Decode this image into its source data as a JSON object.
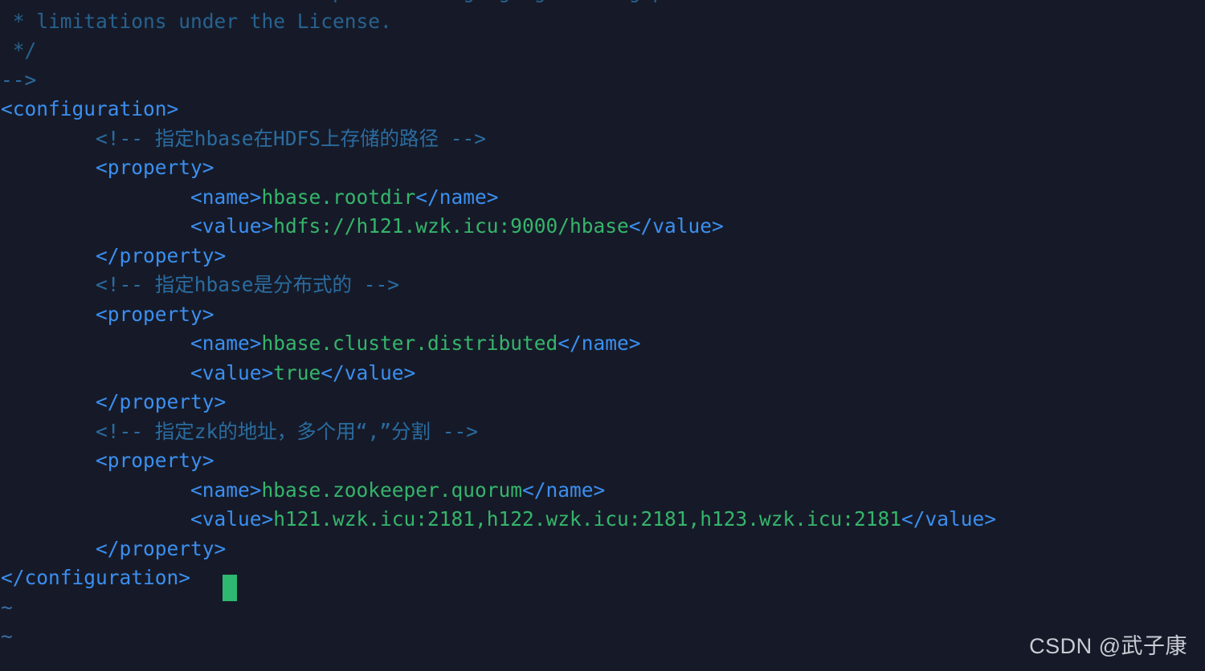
{
  "app": {
    "type": "terminal-text-editor",
    "editor": "vim",
    "file": "hbase-site.xml",
    "mode": "normal"
  },
  "theme": {
    "background": "#161a28",
    "tag_color": "#3b8ff0",
    "text_color": "#35b56b",
    "comment_color": "#2a6ca0",
    "dim_comment_color": "#27628f",
    "tilde_color": "#3b6ea8",
    "cursor_color": "#2eb872",
    "watermark_color": "#c9ccd4"
  },
  "cursor": {
    "line": 20,
    "column": 17,
    "shape": "block"
  },
  "lines": [
    {
      "id": "line-license-see",
      "indent": 1,
      "kind": "comment-dim",
      "clipped": true,
      "segments": [
        {
          "cls": "c-comment-d",
          "text": "* See the License for the specific language governing permissions and"
        }
      ]
    },
    {
      "id": "line-license-limitations",
      "indent": 1,
      "kind": "comment-dim",
      "segments": [
        {
          "cls": "c-comment-d",
          "text": "* limitations under the License."
        }
      ]
    },
    {
      "id": "line-comment-close-star",
      "indent": 1,
      "kind": "comment-dim",
      "segments": [
        {
          "cls": "c-comment-d",
          "text": "*/"
        }
      ]
    },
    {
      "id": "line-comment-close-xml",
      "indent": 0,
      "kind": "comment",
      "segments": [
        {
          "cls": "c-comment",
          "text": "-->"
        }
      ]
    },
    {
      "id": "line-configuration-open",
      "indent": 0,
      "kind": "tag",
      "segments": [
        {
          "cls": "c-tag",
          "text": "<configuration>"
        }
      ]
    },
    {
      "id": "line-comment-rootdir",
      "indent": 8,
      "kind": "comment",
      "segments": [
        {
          "cls": "c-comment",
          "text": "<!-- 指定hbase在HDFS上存储的路径 -->"
        }
      ]
    },
    {
      "id": "line-property-open-1",
      "indent": 8,
      "kind": "tag",
      "segments": [
        {
          "cls": "c-tag",
          "text": "<property>"
        }
      ]
    },
    {
      "id": "line-name-rootdir",
      "indent": 16,
      "kind": "element",
      "segments": [
        {
          "cls": "c-tag",
          "text": "<name>"
        },
        {
          "cls": "c-text",
          "text": "hbase.rootdir"
        },
        {
          "cls": "c-tag",
          "text": "</name>"
        }
      ]
    },
    {
      "id": "line-value-rootdir",
      "indent": 16,
      "kind": "element",
      "segments": [
        {
          "cls": "c-tag",
          "text": "<value>"
        },
        {
          "cls": "c-text",
          "text": "hdfs://h121.wzk.icu:9000/hbase"
        },
        {
          "cls": "c-tag",
          "text": "</value>"
        }
      ]
    },
    {
      "id": "line-property-close-1",
      "indent": 8,
      "kind": "tag",
      "segments": [
        {
          "cls": "c-tag",
          "text": "</property>"
        }
      ]
    },
    {
      "id": "line-comment-distributed",
      "indent": 8,
      "kind": "comment",
      "segments": [
        {
          "cls": "c-comment",
          "text": "<!-- 指定hbase是分布式的 -->"
        }
      ]
    },
    {
      "id": "line-property-open-2",
      "indent": 8,
      "kind": "tag",
      "segments": [
        {
          "cls": "c-tag",
          "text": "<property>"
        }
      ]
    },
    {
      "id": "line-name-distributed",
      "indent": 16,
      "kind": "element",
      "segments": [
        {
          "cls": "c-tag",
          "text": "<name>"
        },
        {
          "cls": "c-text",
          "text": "hbase.cluster.distributed"
        },
        {
          "cls": "c-tag",
          "text": "</name>"
        }
      ]
    },
    {
      "id": "line-value-distributed",
      "indent": 16,
      "kind": "element",
      "segments": [
        {
          "cls": "c-tag",
          "text": "<value>"
        },
        {
          "cls": "c-text",
          "text": "true"
        },
        {
          "cls": "c-tag",
          "text": "</value>"
        }
      ]
    },
    {
      "id": "line-property-close-2",
      "indent": 8,
      "kind": "tag",
      "segments": [
        {
          "cls": "c-tag",
          "text": "</property>"
        }
      ]
    },
    {
      "id": "line-comment-zk",
      "indent": 8,
      "kind": "comment",
      "segments": [
        {
          "cls": "c-comment",
          "text": "<!-- 指定zk的地址，多个用“,”分割 -->"
        }
      ]
    },
    {
      "id": "line-property-open-3",
      "indent": 8,
      "kind": "tag",
      "segments": [
        {
          "cls": "c-tag",
          "text": "<property>"
        }
      ]
    },
    {
      "id": "line-name-quorum",
      "indent": 16,
      "kind": "element",
      "segments": [
        {
          "cls": "c-tag",
          "text": "<name>"
        },
        {
          "cls": "c-text",
          "text": "hbase.zookeeper.quorum"
        },
        {
          "cls": "c-tag",
          "text": "</name>"
        }
      ]
    },
    {
      "id": "line-value-quorum",
      "indent": 16,
      "kind": "element",
      "segments": [
        {
          "cls": "c-tag",
          "text": "<value>"
        },
        {
          "cls": "c-text",
          "text": "h121.wzk.icu:2181,h122.wzk.icu:2181,h123.wzk.icu:2181"
        },
        {
          "cls": "c-tag",
          "text": "</value>"
        }
      ]
    },
    {
      "id": "line-property-close-3",
      "indent": 8,
      "kind": "tag",
      "segments": [
        {
          "cls": "c-tag",
          "text": "</property>"
        }
      ]
    },
    {
      "id": "line-configuration-close",
      "indent": 0,
      "kind": "tag",
      "segments": [
        {
          "cls": "c-tag",
          "text": "</configuration>"
        }
      ]
    },
    {
      "id": "line-empty-tilde-1",
      "indent": 0,
      "kind": "tilde",
      "segments": [
        {
          "cls": "c-tilde",
          "text": "~"
        }
      ]
    },
    {
      "id": "line-empty-tilde-2",
      "indent": 0,
      "kind": "tilde",
      "segments": [
        {
          "cls": "c-tilde",
          "text": "~"
        }
      ]
    }
  ],
  "watermark": {
    "text": "CSDN @武子康"
  }
}
